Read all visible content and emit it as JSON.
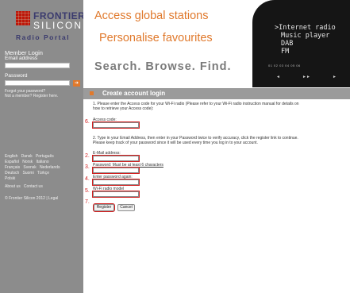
{
  "logo": {
    "line1": "FRONTIER",
    "line2": "SILICON",
    "line3": "Radio Portal"
  },
  "sidebar": {
    "member_login": "Member Login",
    "email_label": "Email address",
    "password_label": "Password",
    "go_arrow": "➔",
    "forgot_password": "Forgot your password?",
    "not_member": "Not a member?",
    "register_here": "Register here.",
    "languages": [
      [
        "English",
        "Dansk",
        "Português"
      ],
      [
        "Español",
        "Norsk",
        "Italiano"
      ],
      [
        "Français",
        "Svensk",
        "Nederlands"
      ],
      [
        "Deutsch",
        "Suomi",
        "Türkçe"
      ],
      [
        "Polski"
      ]
    ],
    "about_us": "About us",
    "contact_us": "Contact us",
    "copyright": "© Frontier Silicon 2012 | Legal"
  },
  "banner": {
    "line1": "Access global stations",
    "line2": "Personalise favourites",
    "line3": "Search. Browse. Find.",
    "display_lines": [
      ">Internet radio",
      "Music player",
      "DAB",
      "FM"
    ],
    "presets": "01  02  03  04  05  06",
    "controls": [
      "◄",
      "►►",
      "►"
    ]
  },
  "header": {
    "title": "Create account login"
  },
  "form": {
    "intro": "1. Please enter the Access code for your Wi-Fi radio (Please refer to your Wi-Fi radio instruction manual for details on",
    "intro2": "how to retrieve your Access code):",
    "access_code_label": "Access code:",
    "step2_line1": "2. Type in your Email Address, then enter in your Password twice to verify accuracy, click the register link to continue.",
    "step2_line2": "Please keep track of your password since it will be used every time you log in to your account.",
    "email_label": "E-Mail address:",
    "password_label": "Password: Must be at least 6 characters",
    "password_again_label": "Enter password again:",
    "radio_model_label": "Wi-Fi radio model",
    "register_button": "Register",
    "cancel_button": "Cancel",
    "step_numbers": [
      "6.",
      "2.",
      "3.",
      "4.",
      "5.",
      "7."
    ]
  }
}
